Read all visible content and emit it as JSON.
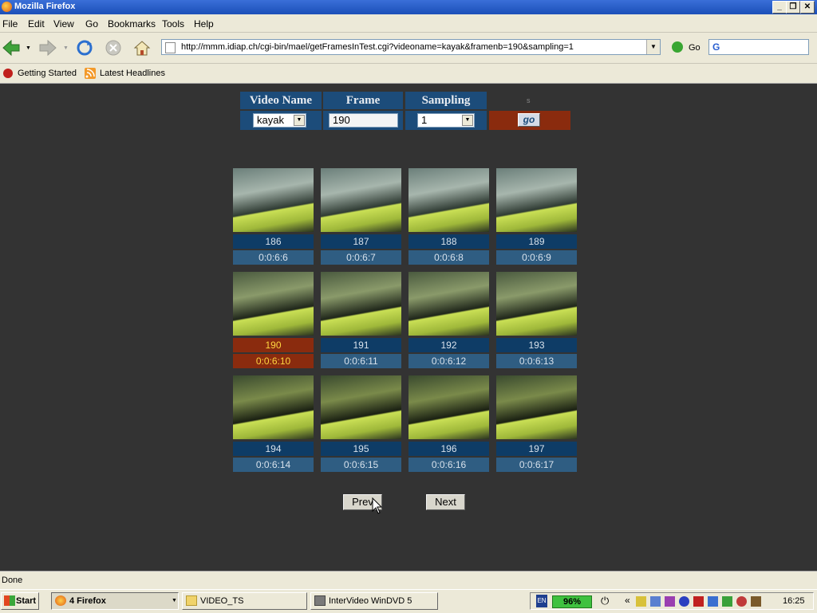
{
  "window": {
    "title": "Mozilla Firefox"
  },
  "menu": [
    "File",
    "Edit",
    "View",
    "Go",
    "Bookmarks",
    "Tools",
    "Help"
  ],
  "nav": {
    "url": "http://mmm.idiap.ch/cgi-bin/mael/getFramesInTest.cgi?videoname=kayak&framenb=190&sampling=1",
    "go_label": "Go"
  },
  "bookmarks": [
    "Getting Started",
    "Latest Headlines"
  ],
  "form": {
    "video_name_header": "Video Name",
    "frame_header": "Frame",
    "sampling_header": "Sampling",
    "tiny_mark": "s",
    "video_name_value": "kayak",
    "frame_value": "190",
    "sampling_value": "1",
    "go_button": "go"
  },
  "frames": [
    {
      "num": "186",
      "time": "0:0:6:6"
    },
    {
      "num": "187",
      "time": "0:0:6:7"
    },
    {
      "num": "188",
      "time": "0:0:6:8"
    },
    {
      "num": "189",
      "time": "0:0:6:9"
    },
    {
      "num": "190",
      "time": "0:0:6:10",
      "current": true
    },
    {
      "num": "191",
      "time": "0:0:6:11"
    },
    {
      "num": "192",
      "time": "0:0:6:12"
    },
    {
      "num": "193",
      "time": "0:0:6:13"
    },
    {
      "num": "194",
      "time": "0:0:6:14"
    },
    {
      "num": "195",
      "time": "0:0:6:15"
    },
    {
      "num": "196",
      "time": "0:0:6:16"
    },
    {
      "num": "197",
      "time": "0:0:6:17"
    }
  ],
  "pager": {
    "prev": "Prev",
    "next": "Next"
  },
  "status": "Done",
  "taskbar": {
    "start": "Start",
    "tasks": [
      "4 Firefox",
      "VIDEO_TS",
      "InterVideo WinDVD 5"
    ],
    "lang": "EN",
    "battery": "96%",
    "clock": "16:25"
  },
  "colors": {
    "header_blue": "#1c4c7a",
    "current_red": "#8a2b0e",
    "current_text": "#ffd640"
  }
}
